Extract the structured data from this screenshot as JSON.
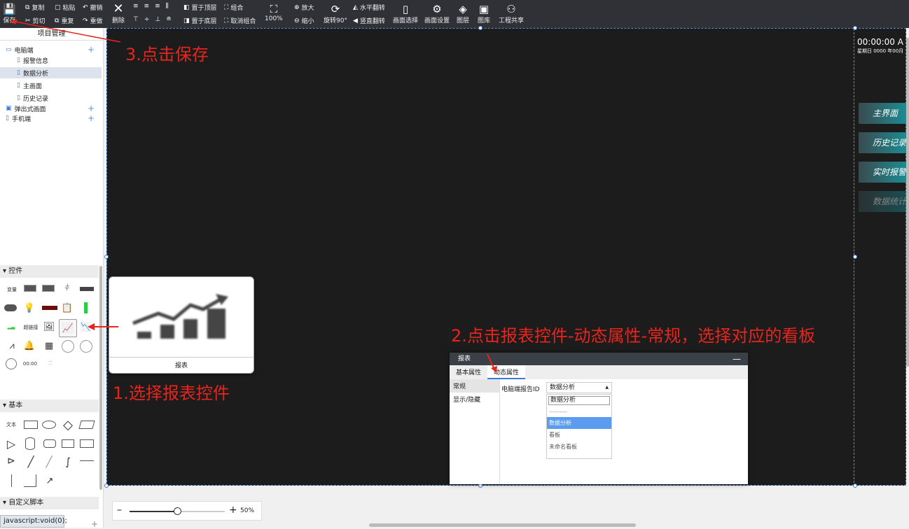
{
  "toolbar": {
    "save": "保存",
    "copy": "复制",
    "paste": "粘贴",
    "undo": "撤销",
    "cut": "剪切",
    "duplicate": "重复",
    "redo": "重做",
    "delete": "删除",
    "bring_top": "置于顶层",
    "send_bottom": "置于底层",
    "group": "组合",
    "ungroup": "取消组合",
    "zoom": "100%",
    "zoom_in": "放大",
    "zoom_out": "缩小",
    "rotate": "旋转90°",
    "flip_h": "水平翻转",
    "flip_v": "竖直翻转",
    "screen_select": "画面选择",
    "screen_settings": "画面设置",
    "layers": "图层",
    "gallery": "图库",
    "share": "工程共享"
  },
  "sidebar": {
    "project_title": "项目管理",
    "tree": [
      {
        "label": "电脑端"
      },
      {
        "label": "报警信息"
      },
      {
        "label": "数据分析"
      },
      {
        "label": "主画面"
      },
      {
        "label": "历史记录"
      },
      {
        "label": "弹出式画面"
      },
      {
        "label": "手机端"
      }
    ],
    "sections": {
      "controls": "控件",
      "basic": "基本",
      "custom_script": "自定义脚本"
    },
    "controls": {
      "variable": "变量",
      "hyperlink": "超链接",
      "clock": "00:00",
      "text": "文本"
    }
  },
  "canvas": {
    "clock": "00:00:00 A",
    "date": "星期日  0000 年00月",
    "nav_buttons": [
      "主界面",
      "历史记录",
      "实时报警",
      "数据统计"
    ]
  },
  "popup": {
    "label": "报表"
  },
  "panel": {
    "title": "报表",
    "tabs": [
      "基本属性",
      "动态属性"
    ],
    "side_items": [
      "常规",
      "显示/隐藏"
    ],
    "field_label": "电脑端报告ID",
    "select_value": "数据分析",
    "search_value": "数据分析",
    "options": [
      "---------",
      "数据分析",
      "看板",
      "未命名看板"
    ]
  },
  "annotations": {
    "step1": "1.选择报表控件",
    "step2": "2.点击报表控件-动态属性-常规，选择对应的看板",
    "step3": "3.点击保存"
  },
  "zoombar": {
    "value": "50%",
    "level": 0.5
  },
  "status": "javascript:void(0);",
  "colors": {
    "annotation": "#e8241c",
    "accent": "#3a7bd5",
    "selected_option": "#5b9bf0"
  }
}
